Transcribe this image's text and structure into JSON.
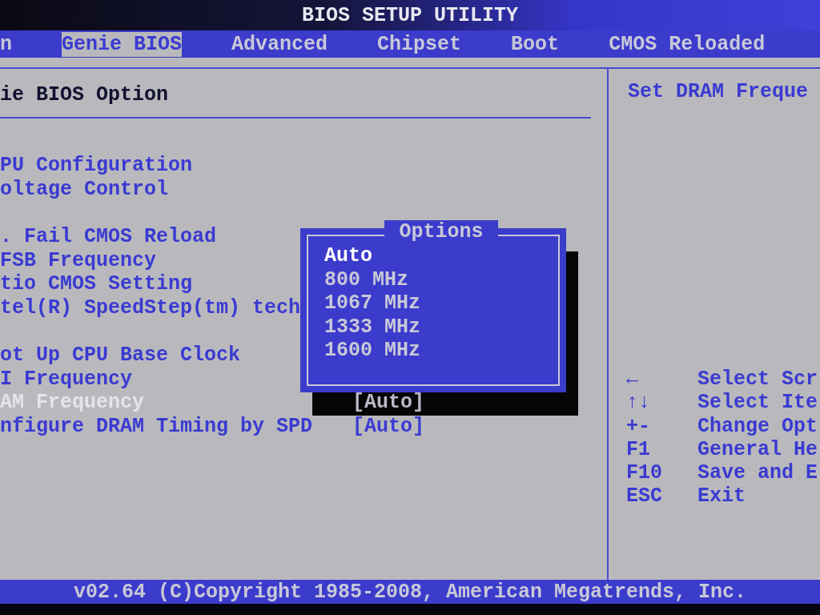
{
  "window": {
    "title": "BIOS SETUP UTILITY"
  },
  "tabs": [
    {
      "label": "n",
      "selected": false
    },
    {
      "label": "Genie BIOS",
      "selected": true
    },
    {
      "label": "Advanced",
      "selected": false
    },
    {
      "label": "Chipset",
      "selected": false
    },
    {
      "label": "Boot",
      "selected": false
    },
    {
      "label": "CMOS Reloaded",
      "selected": false
    }
  ],
  "page_title": "ie BIOS Option",
  "menu": {
    "groups": [
      [
        {
          "label": "PU Configuration",
          "selected": false
        },
        {
          "label": "oltage Control",
          "selected": false
        }
      ],
      [
        {
          "label": ". Fail CMOS Reload",
          "selected": false
        },
        {
          "label": "FSB Frequency",
          "selected": false
        },
        {
          "label": "tio CMOS Setting",
          "selected": false
        },
        {
          "label": "tel(R) SpeedStep(tm) tech",
          "selected": false
        }
      ],
      [
        {
          "label": "ot Up CPU Base Clock",
          "selected": false
        },
        {
          "label": "I Frequency",
          "selected": false
        },
        {
          "label": "AM Frequency",
          "value": "[Auto]",
          "selected": true
        },
        {
          "label": "nfigure DRAM Timing by SPD",
          "value": "[Auto]",
          "selected": false
        }
      ]
    ]
  },
  "popup": {
    "title": "Options",
    "options": [
      {
        "label": "Auto",
        "selected": true
      },
      {
        "label": "800 MHz",
        "selected": false
      },
      {
        "label": "1067 MHz",
        "selected": false
      },
      {
        "label": "1333 MHz",
        "selected": false
      },
      {
        "label": "1600 MHz",
        "selected": false
      }
    ]
  },
  "help": {
    "text": "Set DRAM Freque",
    "keys": [
      {
        "key": "←",
        "action": "Select Scr"
      },
      {
        "key": "↑↓",
        "action": "Select Ite"
      },
      {
        "key": "+-",
        "action": "Change Opt"
      },
      {
        "key": "F1",
        "action": "General He"
      },
      {
        "key": "F10",
        "action": "Save and E"
      },
      {
        "key": "ESC",
        "action": "Exit"
      }
    ]
  },
  "footer": "v02.64 (C)Copyright 1985-2008, American Megatrends, Inc."
}
